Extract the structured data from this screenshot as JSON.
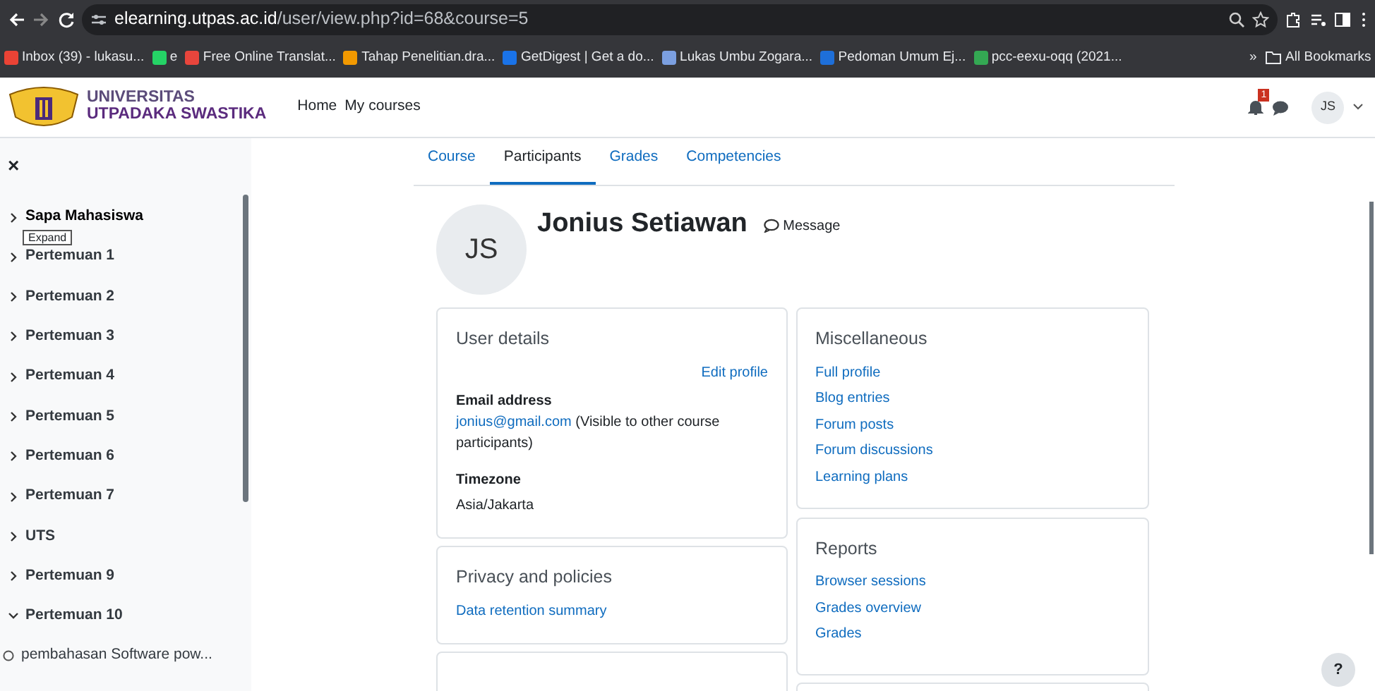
{
  "browser": {
    "url_host": "elearning.utpas.ac.id",
    "url_path": "/user/view.php?id=68&course=5",
    "bookmarks": [
      {
        "label": "Inbox (39) - lukasu...",
        "color": "#ea4335"
      },
      {
        "label": "e",
        "color": "#25d366"
      },
      {
        "label": "Free Online Translat...",
        "color": "#e8453c"
      },
      {
        "label": "Tahap Penelitian.dra...",
        "color": "#f29900"
      },
      {
        "label": "GetDigest | Get a do...",
        "color": "#1a73e8"
      },
      {
        "label": "Lukas Umbu Zogara...",
        "color": "#7b9fe0"
      },
      {
        "label": "Pedoman Umum Ej...",
        "color": "#1e6fd9"
      },
      {
        "label": "pcc-eexu-oqq (2021...",
        "color": "#34a853"
      }
    ],
    "overflow": "»",
    "all_bookmarks": "All Bookmarks"
  },
  "navbar": {
    "brand_line_1": "UNIVERSITAS",
    "brand_line_2": "UTPADAKA SWASTIKA",
    "links": [
      "Home",
      "My courses"
    ],
    "notification_count": "1",
    "avatar_initials": "JS"
  },
  "sidebar": {
    "close": "×",
    "tooltip": "Expand",
    "items": [
      {
        "kind": "section",
        "label": "Sapa Mahasiswa",
        "expanded": false,
        "hovered": true
      },
      {
        "kind": "section",
        "label": "Pertemuan 1",
        "expanded": false,
        "hovered": false
      },
      {
        "kind": "section",
        "label": "Pertemuan 2",
        "expanded": false,
        "hovered": false
      },
      {
        "kind": "section",
        "label": "Pertemuan 3",
        "expanded": false,
        "hovered": false
      },
      {
        "kind": "section",
        "label": "Pertemuan 4",
        "expanded": false,
        "hovered": false
      },
      {
        "kind": "section",
        "label": "Pertemuan 5",
        "expanded": false,
        "hovered": false
      },
      {
        "kind": "section",
        "label": "Pertemuan 6",
        "expanded": false,
        "hovered": false
      },
      {
        "kind": "section",
        "label": "Pertemuan 7",
        "expanded": false,
        "hovered": false
      },
      {
        "kind": "section",
        "label": "UTS",
        "expanded": false,
        "hovered": false
      },
      {
        "kind": "section",
        "label": "Pertemuan 9",
        "expanded": false,
        "hovered": false
      },
      {
        "kind": "section",
        "label": "Pertemuan 10",
        "expanded": true,
        "hovered": false
      },
      {
        "kind": "activity",
        "label": "pembahasan Software pow..."
      }
    ]
  },
  "tabs": [
    {
      "label": "Course",
      "selected": false
    },
    {
      "label": "Participants",
      "selected": true
    },
    {
      "label": "Grades",
      "selected": false
    },
    {
      "label": "Competencies",
      "selected": false
    }
  ],
  "profile": {
    "initials": "JS",
    "name": "Jonius Setiawan",
    "message": "Message"
  },
  "user_details": {
    "title": "User details",
    "edit": "Edit profile",
    "email_label": "Email address",
    "email": "jonius@gmail.com",
    "email_note": "(Visible to other course participants)",
    "timezone_label": "Timezone",
    "timezone": "Asia/Jakarta"
  },
  "privacy": {
    "title": "Privacy and policies",
    "links": [
      "Data retention summary"
    ]
  },
  "miscellaneous": {
    "title": "Miscellaneous",
    "links": [
      "Full profile",
      "Blog entries",
      "Forum posts",
      "Forum discussions",
      "Learning plans"
    ]
  },
  "reports": {
    "title": "Reports",
    "links": [
      "Browser sessions",
      "Grades overview",
      "Grades"
    ]
  },
  "help": "?"
}
